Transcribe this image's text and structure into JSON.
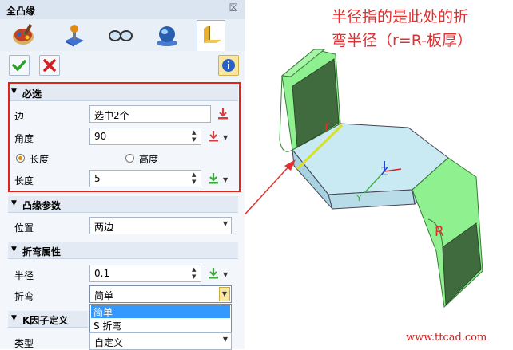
{
  "window": {
    "title": "全凸缘",
    "close_glyph": "☒"
  },
  "tool_icons": [
    "paint-bucket-icon",
    "joystick-icon",
    "glasses-icon",
    "globe-icon",
    "sheet-flange-icon"
  ],
  "sections": {
    "required": {
      "title": "必选",
      "edge_label": "边",
      "edge_value": "选中2个",
      "angle_label": "角度",
      "angle_value": "90",
      "radio_length": "长度",
      "radio_height": "高度",
      "radio_selected": "长度",
      "length_label": "长度",
      "length_value": "5"
    },
    "flange_params": {
      "title": "凸缘参数",
      "position_label": "位置",
      "position_value": "两边"
    },
    "bend_props": {
      "title": "折弯属性",
      "radius_label": "半径",
      "radius_value": "0.1",
      "bend_label": "折弯",
      "bend_value": "简单",
      "options": [
        "简单",
        "S 折弯"
      ]
    },
    "k_factor": {
      "title": "K因子定义",
      "type_label": "类型",
      "type_value": "自定义"
    }
  },
  "annotation": {
    "line1": "半径指的是此处的折",
    "line2": "弯半径（r=R-板厚）"
  },
  "model_labels": {
    "r": "r",
    "R": "R",
    "z": "Z",
    "y": "Y"
  },
  "watermark": "www.ttcad.com",
  "colors": {
    "accent_red": "#e2231a",
    "flange_green": "#8ef08e",
    "flange_dark": "#3f6b3f",
    "plate": "#c9eaf2"
  }
}
